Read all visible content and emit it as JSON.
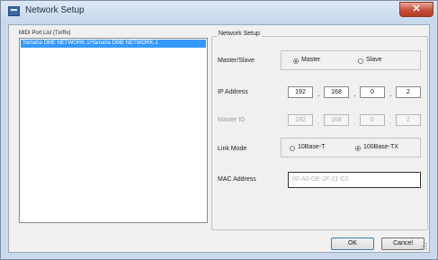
{
  "window": {
    "title": "Network Setup",
    "close_symbol": "✕"
  },
  "midi_port_list": {
    "header": "MIDI Port List (Tx/Rx)",
    "items": [
      "Yamaha DME NETWORK-1/Yamaha DME NETWORK-1"
    ]
  },
  "network_setup": {
    "group_title": "Network Setup",
    "master_slave": {
      "label": "Master/Slave",
      "options": [
        "Master",
        "Slave"
      ],
      "selected": "Master"
    },
    "ip_address": {
      "label": "IP Address",
      "octets": [
        "192",
        "168",
        "0",
        "2"
      ]
    },
    "master_id": {
      "label": "Master ID",
      "octets": [
        "192",
        "168",
        "0",
        "2"
      ]
    },
    "link_mode": {
      "label": "Link Mode",
      "options": [
        "10Base-T",
        "100Base-TX"
      ],
      "selected": "100Base-TX"
    },
    "mac_address": {
      "label": "MAC Address",
      "value": "00-A0-DE-2F-21-C0"
    },
    "separator": "."
  },
  "buttons": {
    "ok": "OK",
    "cancel": "Cancel"
  }
}
